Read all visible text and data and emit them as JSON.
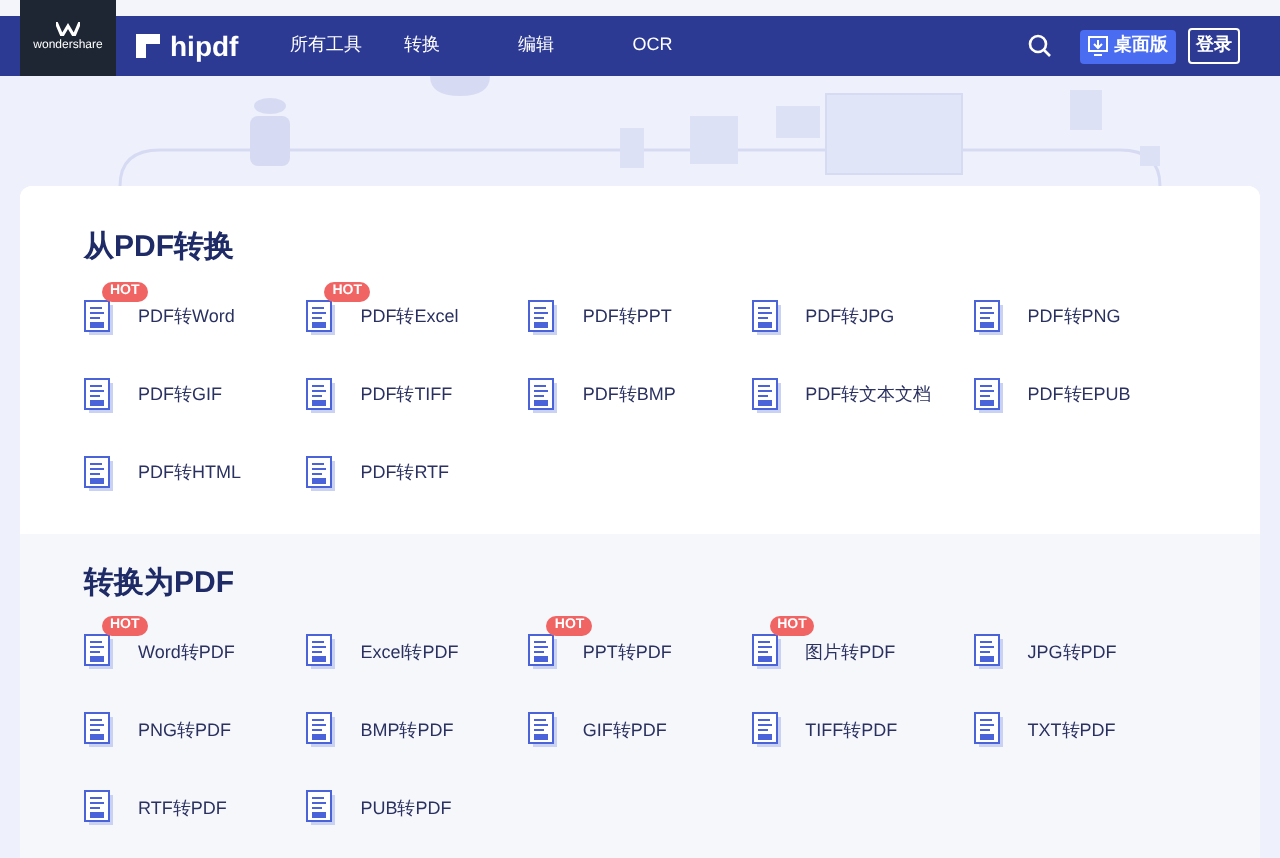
{
  "brand": {
    "company": "wondershare",
    "product": "hipdf"
  },
  "nav": [
    {
      "label": "所有工具"
    },
    {
      "label": "转换"
    },
    {
      "label": "编辑"
    },
    {
      "label": "OCR"
    }
  ],
  "desktop_button": "桌面版",
  "login_button": "登录",
  "sections": [
    {
      "title": "从PDF转换",
      "tools": [
        {
          "label": "PDF转Word",
          "badge": "HOT"
        },
        {
          "label": "PDF转Excel",
          "badge": "HOT"
        },
        {
          "label": "PDF转PPT"
        },
        {
          "label": "PDF转JPG"
        },
        {
          "label": "PDF转PNG"
        },
        {
          "label": "PDF转GIF"
        },
        {
          "label": "PDF转TIFF"
        },
        {
          "label": "PDF转BMP"
        },
        {
          "label": "PDF转文本文档"
        },
        {
          "label": "PDF转EPUB"
        },
        {
          "label": "PDF转HTML"
        },
        {
          "label": "PDF转RTF"
        }
      ]
    },
    {
      "title": "转换为PDF",
      "tools": [
        {
          "label": "Word转PDF",
          "badge": "HOT"
        },
        {
          "label": "Excel转PDF"
        },
        {
          "label": "PPT转PDF",
          "badge": "HOT"
        },
        {
          "label": "图片转PDF",
          "badge": "HOT"
        },
        {
          "label": "JPG转PDF"
        },
        {
          "label": "PNG转PDF"
        },
        {
          "label": "BMP转PDF"
        },
        {
          "label": "GIF转PDF"
        },
        {
          "label": "TIFF转PDF"
        },
        {
          "label": "TXT转PDF"
        },
        {
          "label": "RTF转PDF"
        },
        {
          "label": "PUB转PDF"
        }
      ]
    }
  ]
}
